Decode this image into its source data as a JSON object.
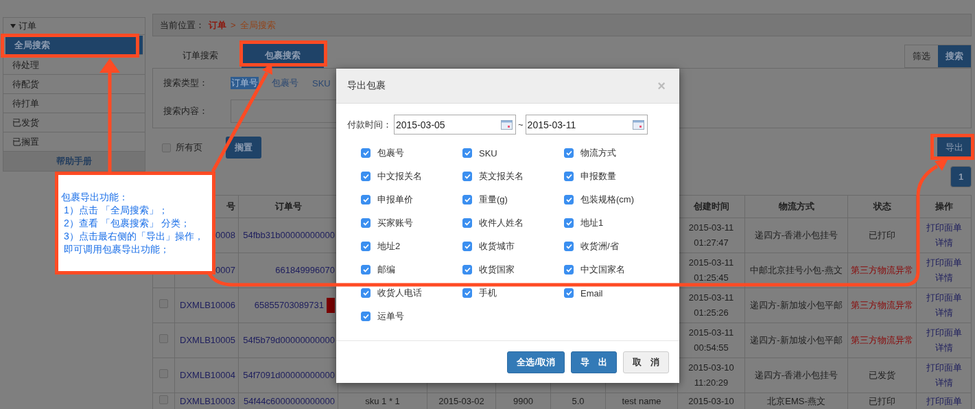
{
  "breadcrumb": {
    "label": "当前位置：",
    "items": [
      "订单",
      "全局搜索"
    ],
    "separator": ">"
  },
  "sidebar": {
    "title": "订单",
    "items": [
      {
        "label": "全局搜索",
        "selected": true
      },
      {
        "label": "待处理",
        "selected": false
      },
      {
        "label": "待配货",
        "selected": false
      },
      {
        "label": "待打单",
        "selected": false
      },
      {
        "label": "已发货",
        "selected": false
      },
      {
        "label": "已搁置",
        "selected": false
      }
    ],
    "help": "帮助手册"
  },
  "search_tabs": [
    {
      "label": "订单搜索",
      "selected": false
    },
    {
      "label": "包裹搜索",
      "selected": true
    }
  ],
  "view_toggle": [
    {
      "label": "筛选",
      "selected": false
    },
    {
      "label": "搜索",
      "selected": true
    }
  ],
  "search_panel": {
    "type_label": "搜索类型：",
    "types": [
      {
        "label": "订单号",
        "selected": true
      },
      {
        "label": "包裹号",
        "selected": false
      },
      {
        "label": "SKU",
        "selected": false
      }
    ],
    "content_label": "搜索内容："
  },
  "actions": {
    "all_pages": {
      "label": "所有页",
      "checked": false
    },
    "hold_button": "搁置",
    "export_button": "导出"
  },
  "pagination": [
    {
      "label": "1",
      "selected": true
    }
  ],
  "table": {
    "headers": {
      "package_no": "号",
      "order_no": "订单号",
      "created": "创建时间",
      "shipping": "物流方式",
      "status": "状态",
      "actions": "操作"
    },
    "rows": [
      {
        "package_no": "0008",
        "order_no": "54fbb31b00000000000",
        "created": [
          "2015-03-11",
          "01:27:47"
        ],
        "shipping": "递四方-香港小包挂号",
        "status": {
          "label": "已打印",
          "color": "#1e1e1e"
        },
        "actions": [
          "打印面单",
          "详情"
        ]
      },
      {
        "package_no": "0007",
        "order_no": "661849996070",
        "created": [
          "2015-03-11",
          "01:25:45"
        ],
        "shipping": "中邮北京挂号小包-燕文",
        "status": {
          "label": "第三方物流异常",
          "color": "#8a0a0a"
        },
        "actions": [
          "打印面单",
          "详情"
        ]
      },
      {
        "checked": false,
        "package_no": "DXMLB10006",
        "order_no": "65855703089731",
        "flagged": true,
        "created": [
          "2015-03-11",
          "01:25:26"
        ],
        "shipping": "递四方-新加坡小包平邮",
        "status": {
          "label": "第三方物流异常",
          "color": "#8a0a0a"
        },
        "actions": [
          "打印面单",
          "详情"
        ]
      },
      {
        "checked": false,
        "package_no": "DXMLB10005",
        "order_no": "54f5b79d00000000000",
        "created": [
          "2015-03-11",
          "00:54:55"
        ],
        "shipping": "递四方-新加坡小包平邮",
        "status": {
          "label": "第三方物流异常",
          "color": "#8a0a0a"
        },
        "actions": [
          "打印面单",
          "详情"
        ]
      },
      {
        "checked": false,
        "package_no": "DXMLB10004",
        "order_no": "54f7091d00000000000",
        "created": [
          "2015-03-10",
          "11:20:29"
        ],
        "shipping": "递四方-香港小包挂号",
        "status": {
          "label": "已发货",
          "color": "#1e1e1e"
        },
        "actions": [
          "打印面单",
          "详情"
        ]
      },
      {
        "checked": false,
        "package_no": "DXMLB10003",
        "order_no": "54f44c6000000000000",
        "col_4": "sku 1 * 1",
        "col_5": "2015-03-02",
        "col_6": "9900",
        "col_7": "5.0",
        "col_8": "test name",
        "created": [
          "2015-03-10"
        ],
        "shipping": "北京EMS-燕文",
        "status": {
          "label": "已打印",
          "color": "#1e1e1e"
        },
        "actions": [
          "打印面单"
        ]
      }
    ]
  },
  "modal": {
    "title": "导出包裹",
    "close": "×",
    "date_label": "付款时间：",
    "date_from": "2015-03-05",
    "date_sep": "~",
    "date_to": "2015-03-11",
    "fields": [
      {
        "label": "包裹号",
        "checked": true
      },
      {
        "label": "SKU",
        "checked": true
      },
      {
        "label": "物流方式",
        "checked": true
      },
      {
        "label": "中文报关名",
        "checked": true
      },
      {
        "label": "英文报关名",
        "checked": true
      },
      {
        "label": "申报数量",
        "checked": true
      },
      {
        "label": "申报单价",
        "checked": true
      },
      {
        "label": "重量(g)",
        "checked": true
      },
      {
        "label": "包装规格(cm)",
        "checked": true
      },
      {
        "label": "买家账号",
        "checked": true
      },
      {
        "label": "收件人姓名",
        "checked": true
      },
      {
        "label": "地址1",
        "checked": true
      },
      {
        "label": "地址2",
        "checked": true
      },
      {
        "label": "收货城市",
        "checked": true
      },
      {
        "label": "收货洲/省",
        "checked": true
      },
      {
        "label": "邮编",
        "checked": true
      },
      {
        "label": "收货国家",
        "checked": true
      },
      {
        "label": "中文国家名",
        "checked": true
      },
      {
        "label": "收货人电话",
        "checked": true
      },
      {
        "label": "手机",
        "checked": true
      },
      {
        "label": "Email",
        "checked": true
      },
      {
        "label": "运单号",
        "checked": true
      }
    ],
    "buttons": [
      {
        "label": "全选/取消",
        "kind": "primary"
      },
      {
        "label": "导　出",
        "kind": "primary"
      },
      {
        "label": "取　消",
        "kind": "default"
      }
    ]
  },
  "callout": {
    "lines": [
      "包裹导出功能：",
      "1）点击 「全局搜索」；",
      "2）查看 「包裹搜索」 分类；",
      "3）点击最右侧的「导出」操作，即可调用包裹导出功能；"
    ]
  }
}
